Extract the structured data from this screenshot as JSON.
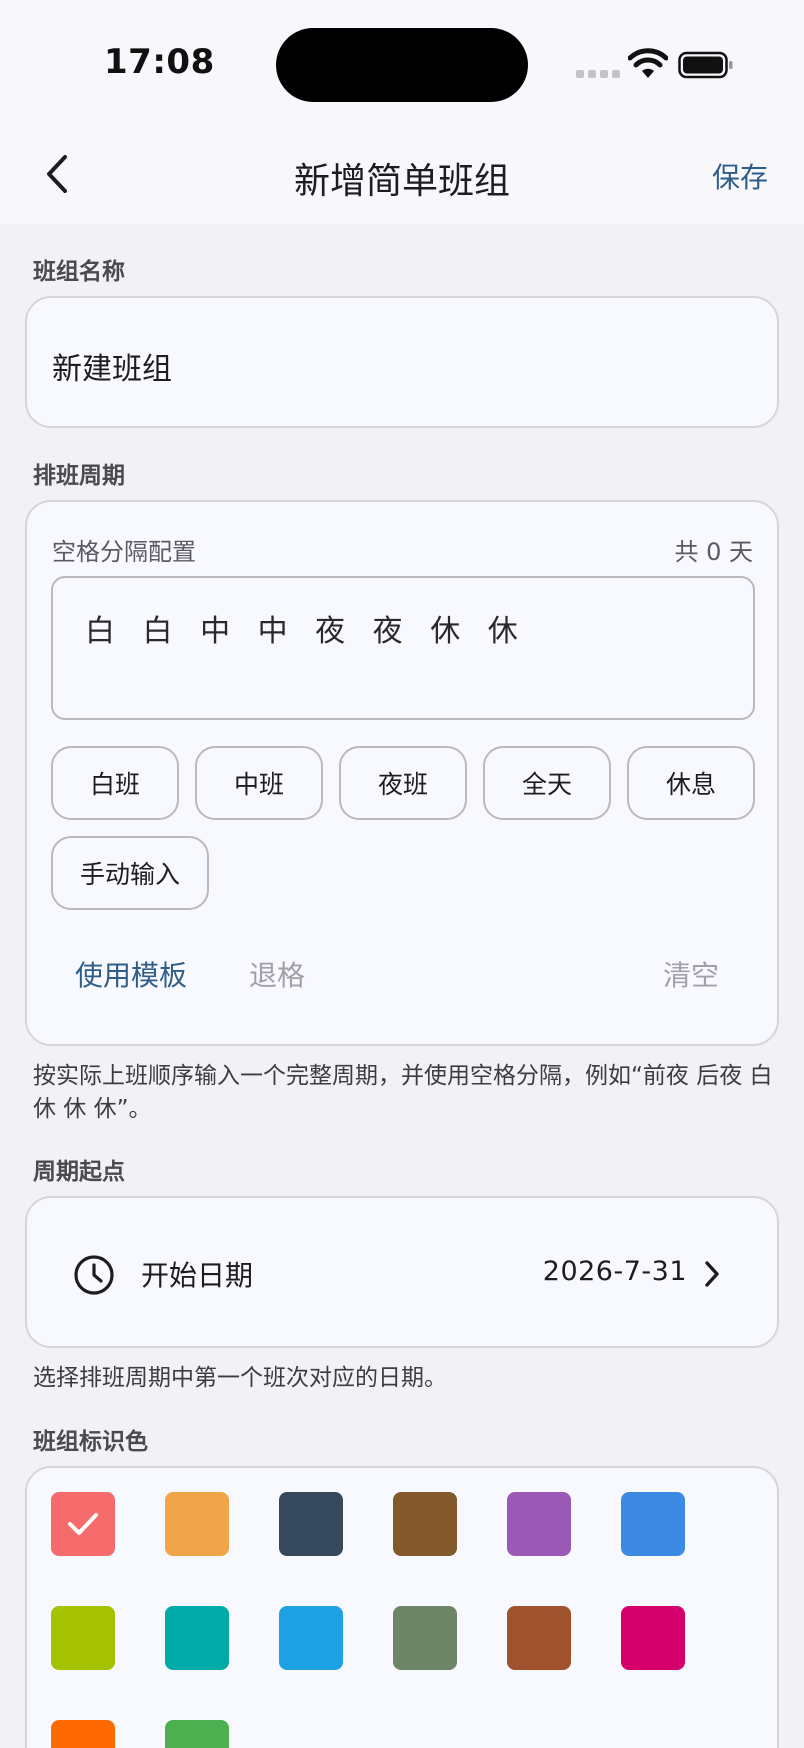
{
  "status": {
    "time": "17:08"
  },
  "nav": {
    "title": "新增简单班组",
    "save_label": "保存"
  },
  "group_name": {
    "label": "班组名称",
    "value": "新建班组"
  },
  "cycle": {
    "label": "排班周期",
    "config_label": "空格分隔配置",
    "count_text": "共 0 天",
    "input_value": "白 白 中 中 夜 夜 休 休",
    "chips": [
      "白班",
      "中班",
      "夜班",
      "全天",
      "休息",
      "手动输入"
    ],
    "use_template": "使用模板",
    "backspace": "退格",
    "clear": "清空",
    "helper": "按实际上班顺序输入一个完整周期，并使用空格分隔，例如“前夜 后夜 白 休 休 休”。"
  },
  "start": {
    "label": "周期起点",
    "date_label": "开始日期",
    "date_value": "2026-7-31",
    "helper": "选择排班周期中第一个班次对应的日期。",
    "icon": "clock-icon"
  },
  "color": {
    "label": "班组标识色",
    "selected_index": 0,
    "swatches": [
      "#f56a6a",
      "#f2a44b",
      "#34495e",
      "#845a2c",
      "#9b59b6",
      "#3d8ae4",
      "#a5c200",
      "#00aaa6",
      "#1ea1e3",
      "#6d8766",
      "#a0522d",
      "#d6006c",
      "#ff6a00",
      "#4caf50"
    ]
  }
}
